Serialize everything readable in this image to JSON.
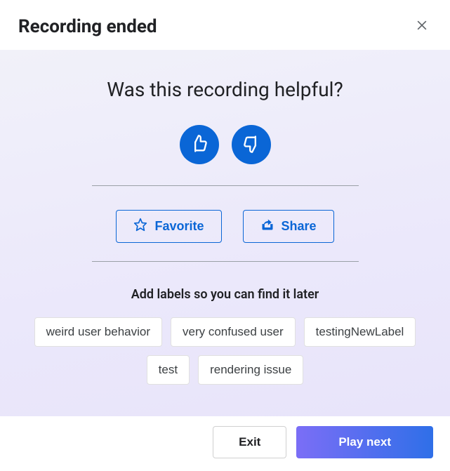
{
  "header": {
    "title": "Recording ended"
  },
  "feedback": {
    "question": "Was this recording helpful?"
  },
  "actions": {
    "favorite_label": "Favorite",
    "share_label": "Share"
  },
  "labels": {
    "heading": "Add labels so you can find it later",
    "items": [
      "weird user behavior",
      "very confused user",
      "testingNewLabel",
      "test",
      "rendering issue"
    ]
  },
  "footer": {
    "exit_label": "Exit",
    "play_next_label": "Play next"
  }
}
